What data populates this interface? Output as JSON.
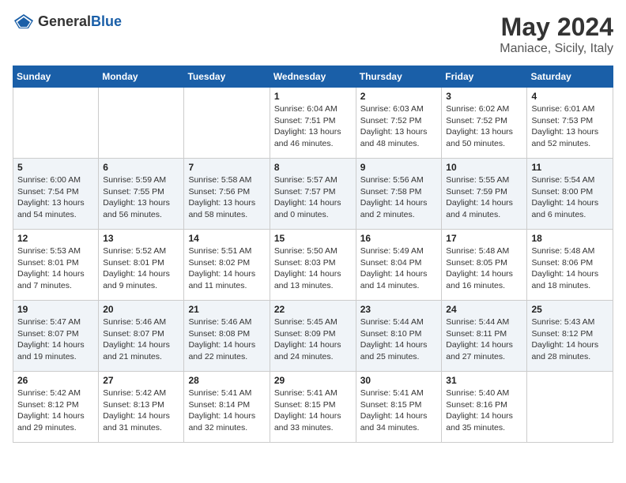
{
  "header": {
    "logo_general": "General",
    "logo_blue": "Blue",
    "month": "May 2024",
    "location": "Maniace, Sicily, Italy"
  },
  "weekdays": [
    "Sunday",
    "Monday",
    "Tuesday",
    "Wednesday",
    "Thursday",
    "Friday",
    "Saturday"
  ],
  "weeks": [
    [
      {
        "day": "",
        "info": ""
      },
      {
        "day": "",
        "info": ""
      },
      {
        "day": "",
        "info": ""
      },
      {
        "day": "1",
        "info": "Sunrise: 6:04 AM\nSunset: 7:51 PM\nDaylight: 13 hours\nand 46 minutes."
      },
      {
        "day": "2",
        "info": "Sunrise: 6:03 AM\nSunset: 7:52 PM\nDaylight: 13 hours\nand 48 minutes."
      },
      {
        "day": "3",
        "info": "Sunrise: 6:02 AM\nSunset: 7:52 PM\nDaylight: 13 hours\nand 50 minutes."
      },
      {
        "day": "4",
        "info": "Sunrise: 6:01 AM\nSunset: 7:53 PM\nDaylight: 13 hours\nand 52 minutes."
      }
    ],
    [
      {
        "day": "5",
        "info": "Sunrise: 6:00 AM\nSunset: 7:54 PM\nDaylight: 13 hours\nand 54 minutes."
      },
      {
        "day": "6",
        "info": "Sunrise: 5:59 AM\nSunset: 7:55 PM\nDaylight: 13 hours\nand 56 minutes."
      },
      {
        "day": "7",
        "info": "Sunrise: 5:58 AM\nSunset: 7:56 PM\nDaylight: 13 hours\nand 58 minutes."
      },
      {
        "day": "8",
        "info": "Sunrise: 5:57 AM\nSunset: 7:57 PM\nDaylight: 14 hours\nand 0 minutes."
      },
      {
        "day": "9",
        "info": "Sunrise: 5:56 AM\nSunset: 7:58 PM\nDaylight: 14 hours\nand 2 minutes."
      },
      {
        "day": "10",
        "info": "Sunrise: 5:55 AM\nSunset: 7:59 PM\nDaylight: 14 hours\nand 4 minutes."
      },
      {
        "day": "11",
        "info": "Sunrise: 5:54 AM\nSunset: 8:00 PM\nDaylight: 14 hours\nand 6 minutes."
      }
    ],
    [
      {
        "day": "12",
        "info": "Sunrise: 5:53 AM\nSunset: 8:01 PM\nDaylight: 14 hours\nand 7 minutes."
      },
      {
        "day": "13",
        "info": "Sunrise: 5:52 AM\nSunset: 8:01 PM\nDaylight: 14 hours\nand 9 minutes."
      },
      {
        "day": "14",
        "info": "Sunrise: 5:51 AM\nSunset: 8:02 PM\nDaylight: 14 hours\nand 11 minutes."
      },
      {
        "day": "15",
        "info": "Sunrise: 5:50 AM\nSunset: 8:03 PM\nDaylight: 14 hours\nand 13 minutes."
      },
      {
        "day": "16",
        "info": "Sunrise: 5:49 AM\nSunset: 8:04 PM\nDaylight: 14 hours\nand 14 minutes."
      },
      {
        "day": "17",
        "info": "Sunrise: 5:48 AM\nSunset: 8:05 PM\nDaylight: 14 hours\nand 16 minutes."
      },
      {
        "day": "18",
        "info": "Sunrise: 5:48 AM\nSunset: 8:06 PM\nDaylight: 14 hours\nand 18 minutes."
      }
    ],
    [
      {
        "day": "19",
        "info": "Sunrise: 5:47 AM\nSunset: 8:07 PM\nDaylight: 14 hours\nand 19 minutes."
      },
      {
        "day": "20",
        "info": "Sunrise: 5:46 AM\nSunset: 8:07 PM\nDaylight: 14 hours\nand 21 minutes."
      },
      {
        "day": "21",
        "info": "Sunrise: 5:46 AM\nSunset: 8:08 PM\nDaylight: 14 hours\nand 22 minutes."
      },
      {
        "day": "22",
        "info": "Sunrise: 5:45 AM\nSunset: 8:09 PM\nDaylight: 14 hours\nand 24 minutes."
      },
      {
        "day": "23",
        "info": "Sunrise: 5:44 AM\nSunset: 8:10 PM\nDaylight: 14 hours\nand 25 minutes."
      },
      {
        "day": "24",
        "info": "Sunrise: 5:44 AM\nSunset: 8:11 PM\nDaylight: 14 hours\nand 27 minutes."
      },
      {
        "day": "25",
        "info": "Sunrise: 5:43 AM\nSunset: 8:12 PM\nDaylight: 14 hours\nand 28 minutes."
      }
    ],
    [
      {
        "day": "26",
        "info": "Sunrise: 5:42 AM\nSunset: 8:12 PM\nDaylight: 14 hours\nand 29 minutes."
      },
      {
        "day": "27",
        "info": "Sunrise: 5:42 AM\nSunset: 8:13 PM\nDaylight: 14 hours\nand 31 minutes."
      },
      {
        "day": "28",
        "info": "Sunrise: 5:41 AM\nSunset: 8:14 PM\nDaylight: 14 hours\nand 32 minutes."
      },
      {
        "day": "29",
        "info": "Sunrise: 5:41 AM\nSunset: 8:15 PM\nDaylight: 14 hours\nand 33 minutes."
      },
      {
        "day": "30",
        "info": "Sunrise: 5:41 AM\nSunset: 8:15 PM\nDaylight: 14 hours\nand 34 minutes."
      },
      {
        "day": "31",
        "info": "Sunrise: 5:40 AM\nSunset: 8:16 PM\nDaylight: 14 hours\nand 35 minutes."
      },
      {
        "day": "",
        "info": ""
      }
    ]
  ]
}
